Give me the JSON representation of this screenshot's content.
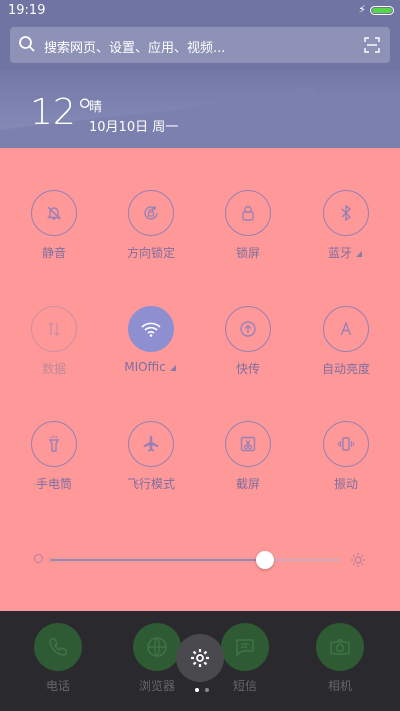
{
  "status": {
    "time": "19:19"
  },
  "search": {
    "placeholder": "搜索网页、设置、应用、视频..."
  },
  "weather": {
    "temperature": "12°",
    "condition": "晴",
    "date": "10月10日 周一"
  },
  "toggles": [
    {
      "label": "静音",
      "icon": "bell-off-icon"
    },
    {
      "label": "方向锁定",
      "icon": "rotation-lock-icon"
    },
    {
      "label": "锁屏",
      "icon": "lock-icon"
    },
    {
      "label": "蓝牙",
      "icon": "bluetooth-icon"
    },
    {
      "label": "数据",
      "icon": "data-icon"
    },
    {
      "label": "MIOffic",
      "icon": "wifi-icon"
    },
    {
      "label": "快传",
      "icon": "share-icon"
    },
    {
      "label": "自动亮度",
      "icon": "auto-brightness-icon"
    },
    {
      "label": "手电筒",
      "icon": "flashlight-icon"
    },
    {
      "label": "飞行模式",
      "icon": "airplane-icon"
    },
    {
      "label": "截屏",
      "icon": "screenshot-icon"
    },
    {
      "label": "振动",
      "icon": "vibrate-icon"
    }
  ],
  "brightness": {
    "level": 0.74
  },
  "dock": [
    {
      "label": "电话",
      "icon": "phone-icon"
    },
    {
      "label": "浏览器",
      "icon": "browser-icon"
    },
    {
      "label": "短信",
      "icon": "message-icon"
    },
    {
      "label": "相机",
      "icon": "camera-icon"
    }
  ],
  "colors": {
    "panel": "#ff9999",
    "accent": "#8e8fd0",
    "wallpaper": "#6f74a3"
  }
}
